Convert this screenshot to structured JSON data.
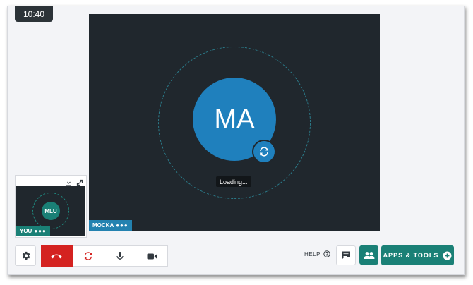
{
  "call": {
    "timer": "10:40"
  },
  "main_participant": {
    "initials": "MA",
    "name": "MOCKA",
    "status_dots": "●●●",
    "loading_text": "Loading..."
  },
  "self_view": {
    "initials": "MLU",
    "name": "YOU",
    "status_dots": "●●●"
  },
  "toolbar": {
    "help_label": "HELP",
    "apps_tools_label": "APPS & TOOLS"
  },
  "colors": {
    "accent": "#1a8076",
    "avatar_blue": "#1f80bd",
    "hangup_red": "#d42220",
    "video_bg": "#20272d"
  }
}
